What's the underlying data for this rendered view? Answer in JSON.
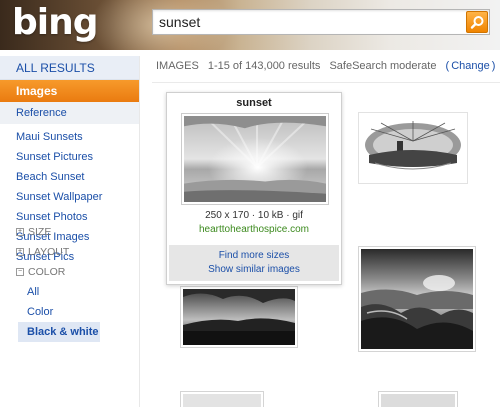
{
  "header": {
    "logo": "bing",
    "search": {
      "value": "sunset"
    }
  },
  "sidebar": {
    "all_results": "ALL RESULTS",
    "images": "Images",
    "reference": "Reference",
    "related": [
      "Maui Sunsets",
      "Sunset Pictures",
      "Beach Sunset",
      "Sunset Wallpaper",
      "Sunset Photos",
      "Sunset Images",
      "Sunset Pics"
    ],
    "filters": {
      "size": "SIZE",
      "layout": "LAYOUT",
      "color": "COLOR",
      "size_icon": "plus-box-icon",
      "layout_icon": "plus-box-icon",
      "color_icon": "minus-box-icon",
      "color_options": [
        "All",
        "Color"
      ],
      "color_selected": "Black & white"
    }
  },
  "results": {
    "label": "IMAGES",
    "range": "1-15 of 143,000 results",
    "safesearch": "SafeSearch moderate",
    "change_open": "(",
    "change": "Change",
    "change_close": ")"
  },
  "hover_card": {
    "title": "sunset",
    "meta": "250 x 170 · 10 kB · gif",
    "url": "hearttohearthospice.com",
    "find_more": "Find more sizes",
    "show_similar": "Show similar images"
  },
  "colors": {
    "accent": "#f08400",
    "link": "#1b4fa8",
    "url_green": "#3c8a1e"
  }
}
